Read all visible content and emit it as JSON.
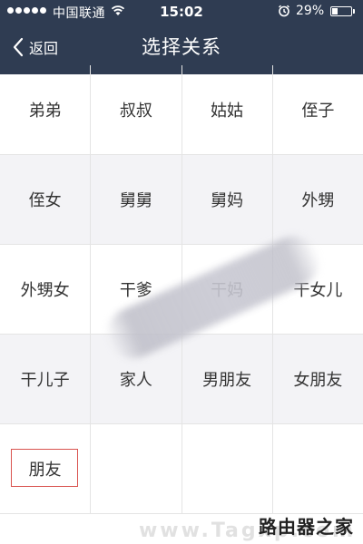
{
  "status_bar": {
    "carrier": "中国联通",
    "time": "15:02",
    "battery_percent": "29%",
    "battery_level": 0.29,
    "icons": [
      "signal-dots-icon",
      "wifi-icon",
      "alarm-icon",
      "battery-icon"
    ]
  },
  "nav": {
    "back_label": "返回",
    "title": "选择关系"
  },
  "grid": {
    "rows": [
      [
        "弟弟",
        "叔叔",
        "姑姑",
        "侄子"
      ],
      [
        "侄女",
        "舅舅",
        "舅妈",
        "外甥"
      ],
      [
        "外甥女",
        "干爹",
        "干妈",
        "干女儿"
      ],
      [
        "干儿子",
        "家人",
        "男朋友",
        "女朋友"
      ],
      [
        "朋友",
        "",
        "",
        ""
      ]
    ],
    "selected": "朋友"
  },
  "watermark": {
    "text": "路由器之家",
    "sub": "www.Tagxp.com"
  },
  "colors": {
    "header_bg": "#2f3c52",
    "selected_border": "#d9534f",
    "alt_row_bg": "#f3f3f6"
  }
}
